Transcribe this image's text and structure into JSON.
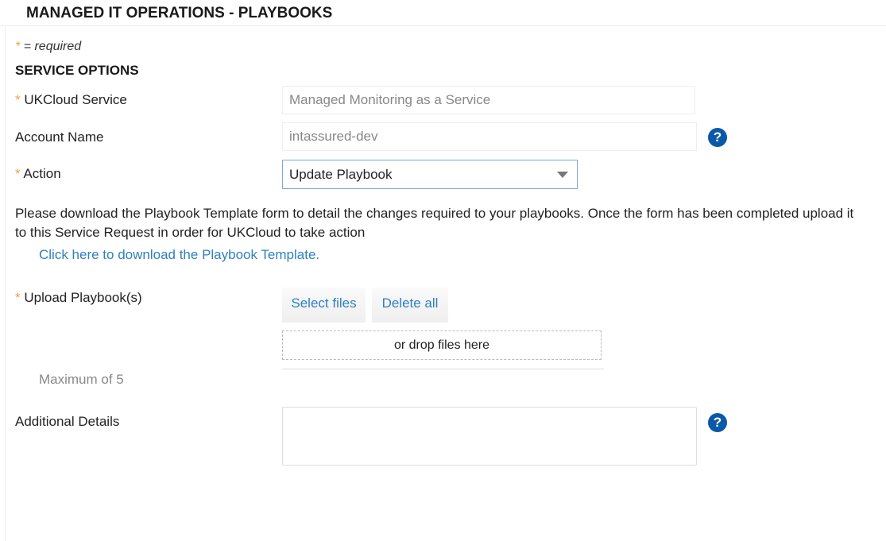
{
  "header": {
    "title": "MANAGED IT OPERATIONS - PLAYBOOKS"
  },
  "form": {
    "required_star": "*",
    "required_note": "= required",
    "section_title": "SERVICE OPTIONS",
    "service": {
      "label": "UKCloud Service",
      "value": "Managed Monitoring as a Service"
    },
    "account": {
      "label": "Account Name",
      "value": "intassured-dev"
    },
    "action": {
      "label": "Action",
      "value": "Update Playbook"
    },
    "instructions": "Please download the Playbook Template form to detail the changes required to your playbooks. Once the form has been completed upload it to this Service Request in order for UKCloud to take action",
    "download_link": "Click here to download the Playbook Template.",
    "upload": {
      "label": "Upload Playbook(s)",
      "select_label": "Select files",
      "delete_label": "Delete all",
      "drop_label": "or drop files here",
      "max_note": "Maximum of 5"
    },
    "details": {
      "label": "Additional Details",
      "value": ""
    },
    "help_glyph": "?"
  },
  "colors": {
    "required": "#f5a13a",
    "link": "#2f80c0",
    "help": "#0a59a8"
  }
}
